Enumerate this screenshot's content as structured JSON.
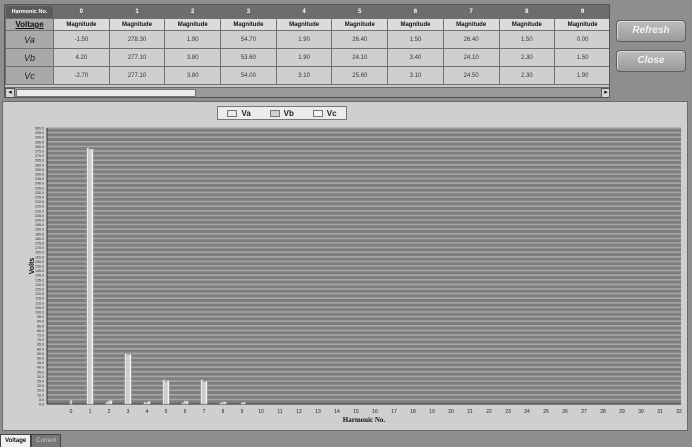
{
  "table": {
    "corner_label": "Harmonic No.",
    "sub_label": "Voltage",
    "harmonics": [
      "0",
      "1",
      "2",
      "3",
      "4",
      "5",
      "6",
      "7",
      "8",
      "9"
    ],
    "col_label": "Magnitude",
    "rows": [
      {
        "label": "Va",
        "values": [
          "-1.50",
          "278.30",
          "1.90",
          "54.70",
          "1.90",
          "26.40",
          "1.50",
          "26.40",
          "1.50",
          "0.00"
        ]
      },
      {
        "label": "Vb",
        "values": [
          "4.20",
          "277.10",
          "3.80",
          "53.60",
          "1.90",
          "24.10",
          "3.40",
          "24.10",
          "2.30",
          "1.50"
        ]
      },
      {
        "label": "Vc",
        "values": [
          "-2.70",
          "277.10",
          "3.80",
          "54.00",
          "3.10",
          "25.60",
          "3.10",
          "24.50",
          "2.30",
          "1.90"
        ]
      }
    ],
    "scroll_left": "◂",
    "scroll_right": "▸"
  },
  "buttons": {
    "refresh": "Refresh",
    "close": "Close"
  },
  "tabs": {
    "voltage": "Voltage",
    "current": "Current"
  },
  "colors": {
    "grid_line": "#a6a6a6",
    "plot_bg": "#7e7e7e",
    "bar_va": "#e8e8e8",
    "bar_vb": "#d2d2d2",
    "bar_vc": "#f4f4f4"
  },
  "chart_data": {
    "type": "bar",
    "ylabel": "Volts",
    "xlabel": "Harmonic No.",
    "ylim": [
      0,
      300
    ],
    "y_tick_step": 5,
    "grid": true,
    "legend_position": "top",
    "categories": [
      "0",
      "1",
      "2",
      "3",
      "4",
      "5",
      "6",
      "7",
      "8",
      "9",
      "10",
      "11",
      "12",
      "13",
      "14",
      "15",
      "16",
      "17",
      "18",
      "19",
      "20",
      "21",
      "22",
      "23",
      "24",
      "25",
      "26",
      "27",
      "28",
      "29",
      "30",
      "31",
      "32"
    ],
    "last_tick_label": "32",
    "series": [
      {
        "name": "Va",
        "values": [
          0,
          278.3,
          1.9,
          54.7,
          1.9,
          26.4,
          1.5,
          26.4,
          1.5,
          0,
          0,
          0,
          0,
          0,
          0,
          0,
          0,
          0,
          0,
          0,
          0,
          0,
          0,
          0,
          0,
          0,
          0,
          0,
          0,
          0,
          0,
          0,
          0
        ]
      },
      {
        "name": "Vb",
        "values": [
          4.2,
          277.1,
          3.8,
          53.6,
          1.9,
          24.1,
          3.4,
          24.1,
          2.3,
          1.5,
          0,
          0,
          0,
          0,
          0,
          0,
          0,
          0,
          0,
          0,
          0,
          0,
          0,
          0,
          0,
          0,
          0,
          0,
          0,
          0,
          0,
          0,
          0
        ]
      },
      {
        "name": "Vc",
        "values": [
          0,
          277.1,
          3.8,
          54.0,
          3.1,
          25.6,
          3.1,
          24.5,
          2.3,
          1.9,
          0,
          0,
          0,
          0,
          0,
          0,
          0,
          0,
          0,
          0,
          0,
          0,
          0,
          0,
          0,
          0,
          0,
          0,
          0,
          0,
          0,
          0,
          0
        ]
      }
    ]
  }
}
